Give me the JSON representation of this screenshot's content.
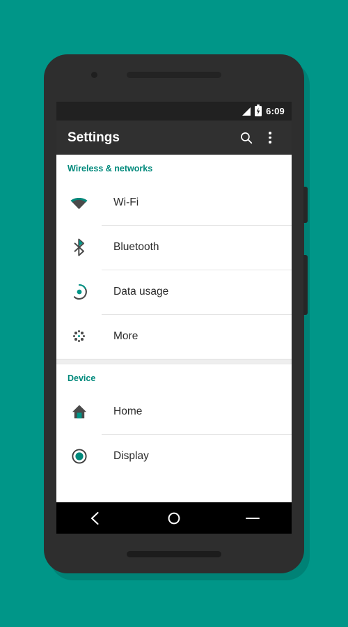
{
  "theme": {
    "background": "#009688",
    "accent": "#009688",
    "section_header_color": "#00897b",
    "app_bar_background": "#303030",
    "status_bar_background": "#212121",
    "screen_background": "#ffffff",
    "nav_bar_background": "#000000",
    "device_body": "#2e2e2e"
  },
  "status_bar": {
    "time": "6:09",
    "signal_icon": "signal-bars-icon",
    "battery_icon": "battery-charging-icon"
  },
  "app_bar": {
    "title": "Settings",
    "search_icon": "search-icon",
    "overflow_icon": "overflow-menu-icon"
  },
  "sections": [
    {
      "header": "Wireless & networks",
      "items": [
        {
          "label": "Wi-Fi",
          "icon": "wifi-icon"
        },
        {
          "label": "Bluetooth",
          "icon": "bluetooth-icon"
        },
        {
          "label": "Data usage",
          "icon": "data-usage-icon"
        },
        {
          "label": "More",
          "icon": "more-dots-icon"
        }
      ]
    },
    {
      "header": "Device",
      "items": [
        {
          "label": "Home",
          "icon": "home-icon"
        },
        {
          "label": "Display",
          "icon": "display-icon"
        }
      ]
    }
  ],
  "nav_bar": {
    "back_icon": "back-chevron-icon",
    "home_icon": "home-circle-icon",
    "recents_icon": "recents-lines-icon"
  },
  "device": {
    "earpiece": "earpiece-speaker",
    "front_camera": "front-camera",
    "bottom_speaker": "bottom-speaker",
    "power_button": "power-button",
    "volume_button": "volume-button"
  }
}
